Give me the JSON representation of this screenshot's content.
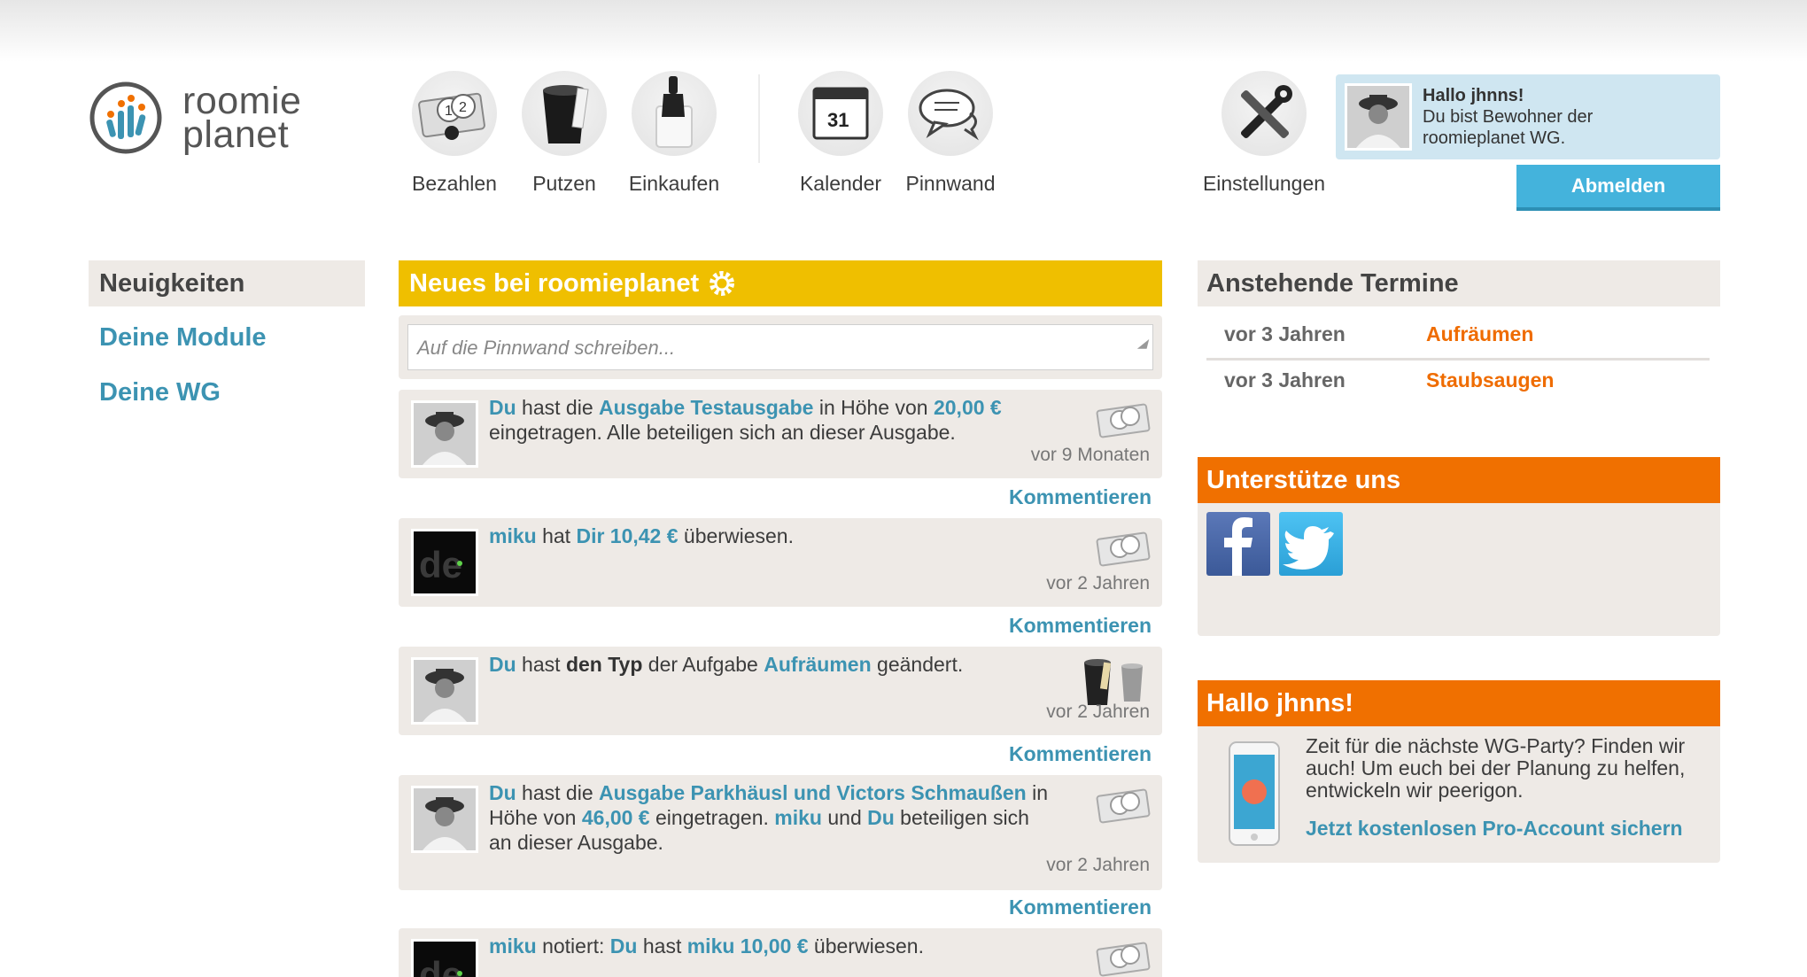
{
  "header": {
    "logo_line1": "roomie",
    "logo_line2": "planet",
    "nav": [
      {
        "label": "Bezahlen",
        "icon": "money-coins-icon"
      },
      {
        "label": "Putzen",
        "icon": "bucket-icon"
      },
      {
        "label": "Einkaufen",
        "icon": "shopping-bag-icon"
      },
      {
        "label": "Kalender",
        "icon": "calendar-icon"
      },
      {
        "label": "Pinnwand",
        "icon": "speech-bubbles-icon"
      },
      {
        "label": "Einstellungen",
        "icon": "tools-icon"
      }
    ],
    "calendar_day": "31",
    "user": {
      "greeting": "Hallo jhnns!",
      "line1": "Du bist Bewohner der",
      "line2": "roomieplanet WG."
    },
    "logout_label": "Abmelden"
  },
  "sidebar": {
    "heading": "Neuigkeiten",
    "links": [
      "Deine Module",
      "Deine WG"
    ]
  },
  "feed": {
    "heading": "Neues bei roomieplanet",
    "placeholder": "Auf die Pinnwand schreiben...",
    "comment_label": "Kommentieren",
    "entries": [
      {
        "t1": "Du",
        "t2": " hast die ",
        "t3": "Ausgabe Testausgabe",
        "t4": " in Höhe von ",
        "t5": "20,00 €",
        "t6": " eingetragen. Alle beteiligen sich an dieser Ausgabe.",
        "time": "vor 9 Monaten"
      },
      {
        "t1": "miku",
        "t2": " hat ",
        "t3": "Dir",
        "t4": " ",
        "t5": "10,42 €",
        "t6": " überwiesen.",
        "time": "vor 2 Jahren"
      },
      {
        "t1": "Du",
        "t2": " hast ",
        "t3": "den Typ",
        "t4": " der Aufgabe ",
        "t5": "Aufräumen",
        "t6": " geändert.",
        "time": "vor 2 Jahren"
      },
      {
        "t1": "Du",
        "t2": " hast die ",
        "t3": "Ausgabe Parkhäusl und Victors Schmaußen",
        "t4": " in Höhe von ",
        "t5": "46,00 €",
        "t6": " eingetragen. ",
        "t7": "miku",
        "t8": " und ",
        "t9": "Du",
        "t10": " beteiligen sich an dieser Ausgabe.",
        "time": "vor 2 Jahren"
      },
      {
        "t1": "miku",
        "t2": " notiert: ",
        "t3": "Du",
        "t4": " hast ",
        "t5": "miku 10,00 €",
        "t6": " überwiesen."
      }
    ]
  },
  "right": {
    "appointments_heading": "Anstehende Termine",
    "appointments": [
      {
        "when": "vor 3 Jahren",
        "what": "Aufräumen"
      },
      {
        "when": "vor 3 Jahren",
        "what": "Staubsaugen"
      }
    ],
    "support_heading": "Unterstütze uns",
    "promo_heading": "Hallo jhnns!",
    "promo_text": "Zeit für die nächste WG-Party? Finden wir auch! Um euch bei der Planung zu helfen, entwickeln wir peerigon.",
    "promo_link": "Jetzt kostenlosen Pro-Account sichern"
  },
  "colors": {
    "accent_blue": "#3c93b2",
    "yellow_header": "#efbf00",
    "orange_header": "#f07000",
    "orange_text": "#ef6c00",
    "logout_blue": "#44b3dc"
  }
}
